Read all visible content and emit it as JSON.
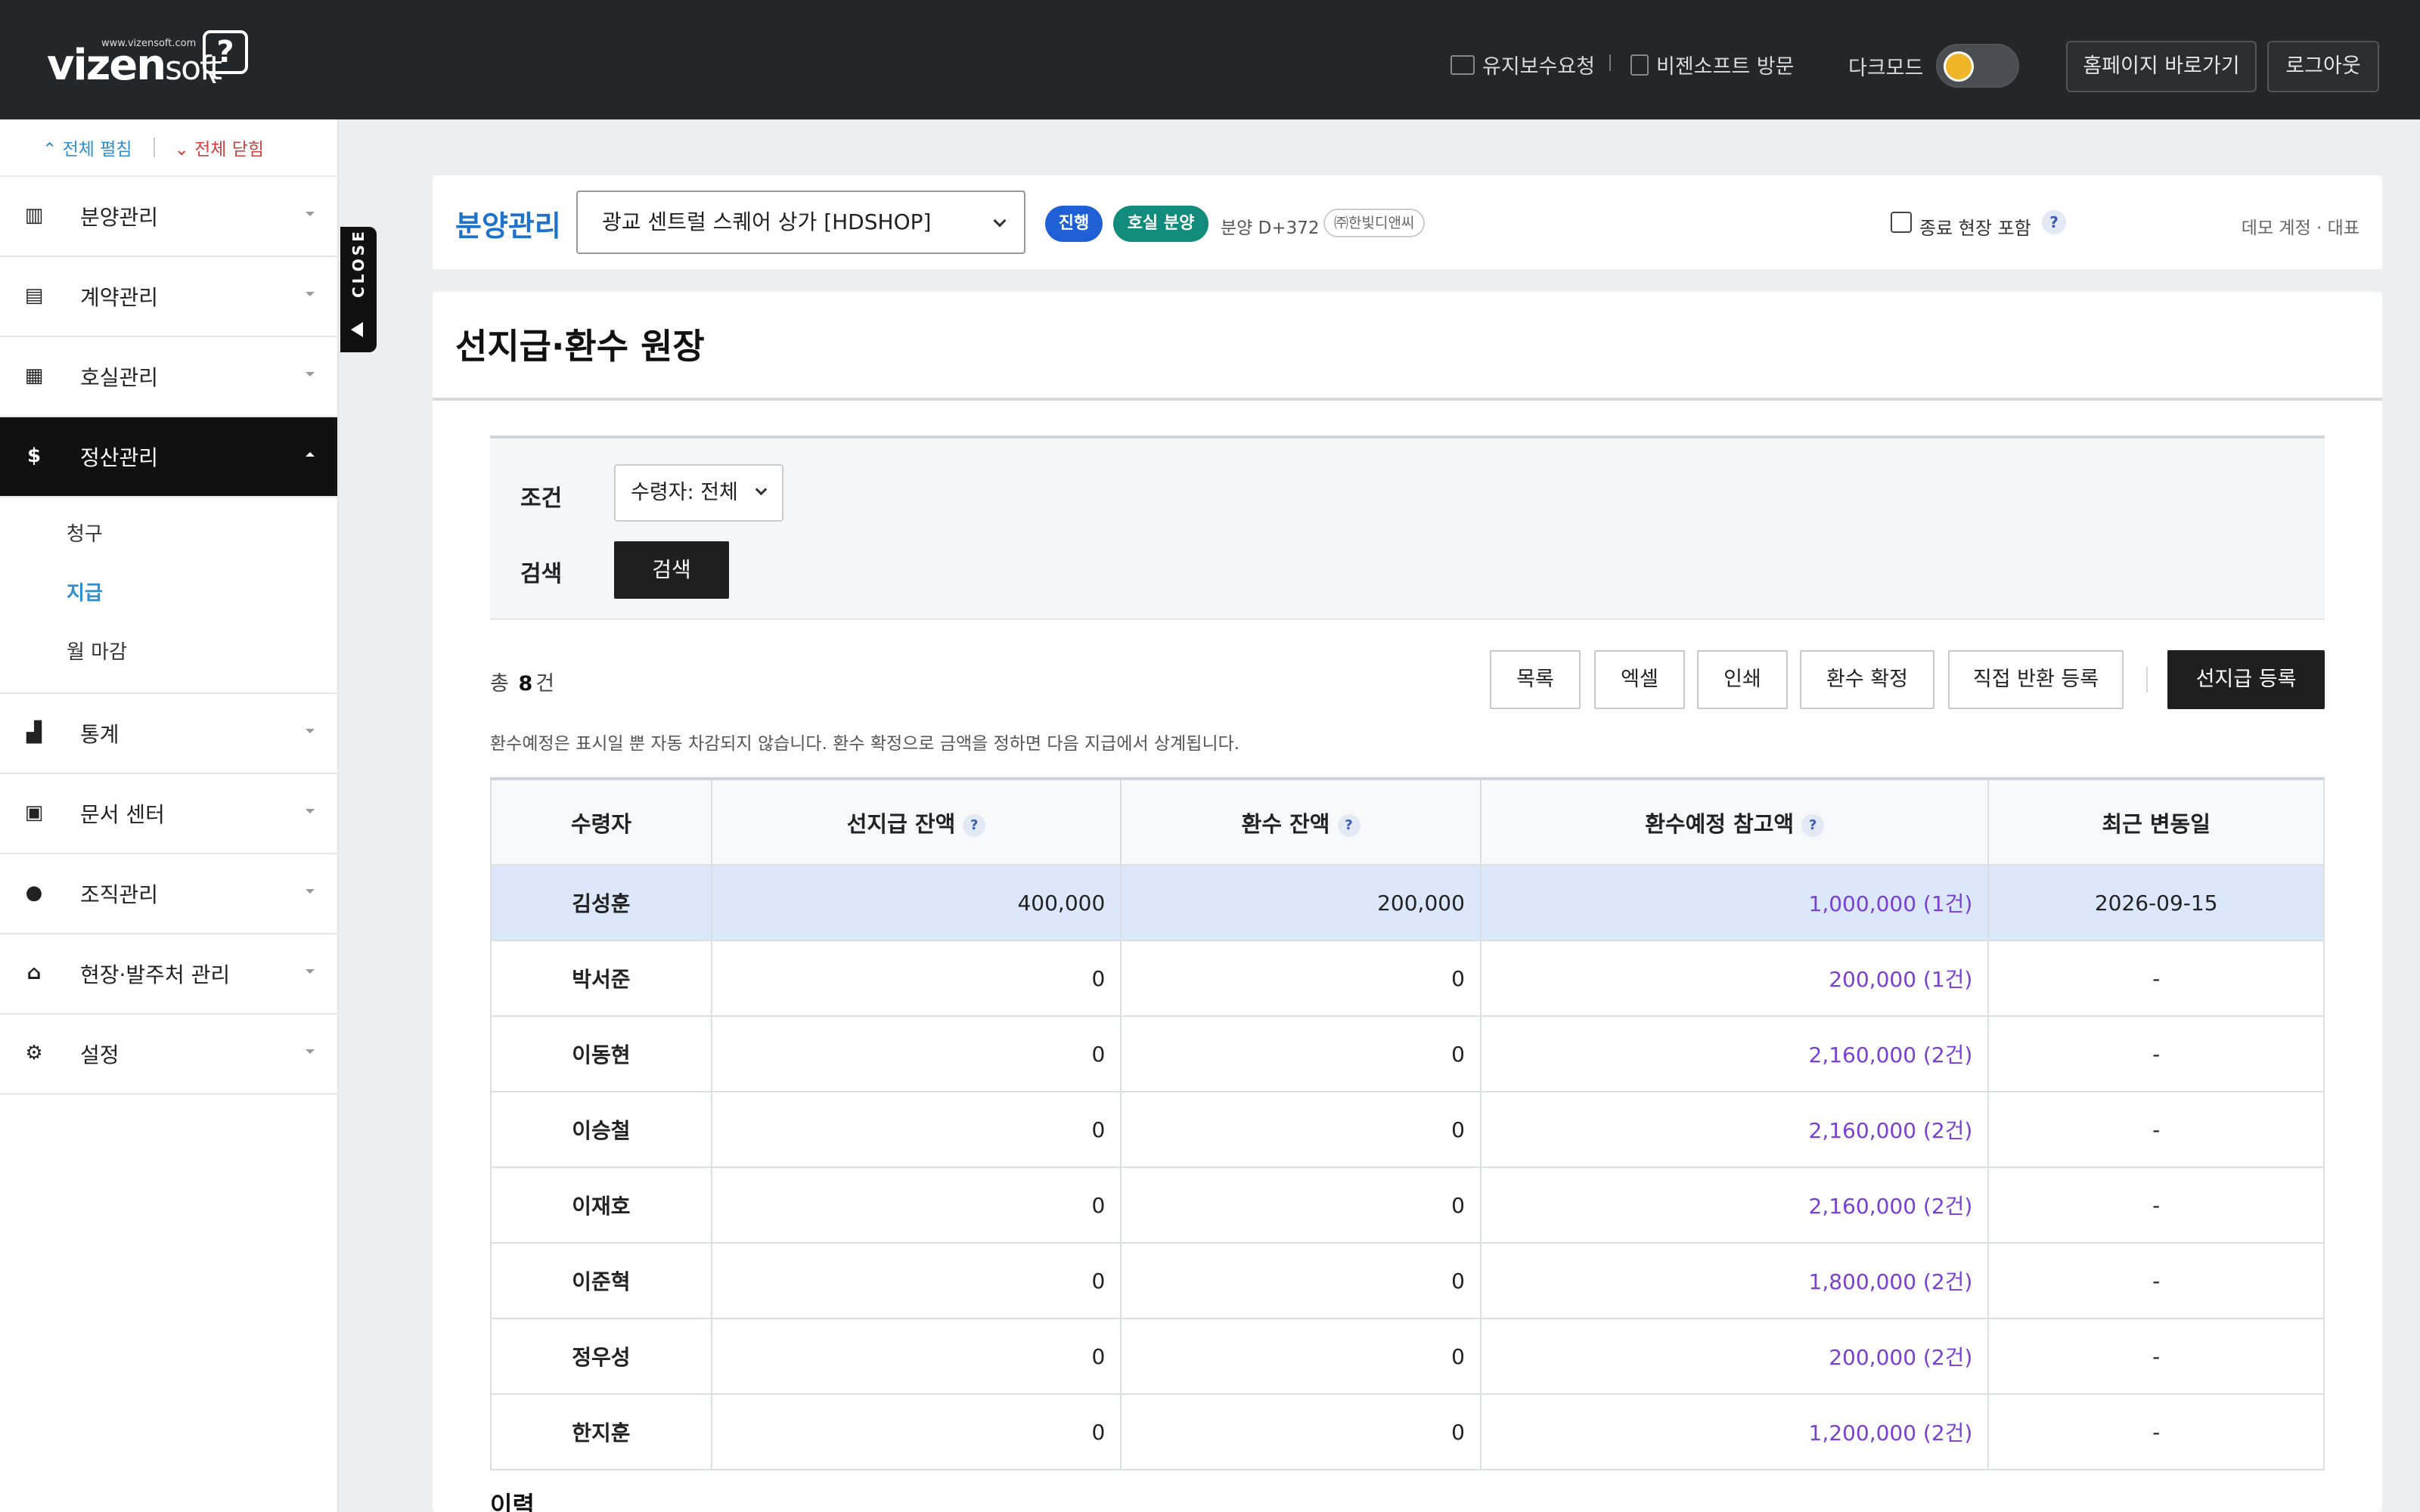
{
  "header": {
    "logo_url": "www.vizensoft.com",
    "logo_brand": "vizen",
    "logo_suffix": "soft",
    "logo_mark": "?",
    "maintenance_label": "유지보수요청",
    "visit_label": "비젠소프트 방문",
    "darkmode_label": "다크모드",
    "homepage_button": "홈페이지 바로가기",
    "logout_button": "로그아웃"
  },
  "sidebar": {
    "expand_all": "⌃ 전체 펼침",
    "collapse_all": "⌄ 전체 닫힘",
    "close_tab": "CLOSE",
    "items": [
      {
        "label": "분양관리",
        "icon": "building-icon"
      },
      {
        "label": "계약관리",
        "icon": "document-icon"
      },
      {
        "label": "호실관리",
        "icon": "grid-icon"
      },
      {
        "label": "정산관리",
        "icon": "dollar-icon"
      },
      {
        "label": "통계",
        "icon": "bar-chart-icon"
      },
      {
        "label": "문서 센터",
        "icon": "pdf-icon"
      },
      {
        "label": "조직관리",
        "icon": "people-icon"
      },
      {
        "label": "현장·발주처 관리",
        "icon": "bank-icon"
      },
      {
        "label": "설정",
        "icon": "settings-icon"
      }
    ],
    "submenu": [
      {
        "label": "청구"
      },
      {
        "label": "지급"
      },
      {
        "label": "월 마감"
      }
    ]
  },
  "site_bar": {
    "title": "분양관리",
    "selected_site": "광교 센트럴 스퀘어 상가 [HDSHOP]",
    "status_pill": "진행",
    "type_pill": "호실 분양",
    "dday": "분양 D+372",
    "company": "㈜한빛디앤씨",
    "include_closed_label": "종료 현장 포함",
    "help": "?",
    "user": "데모 계정 · 대표"
  },
  "page": {
    "title": "선지급·환수 원장",
    "filter": {
      "condition_label": "조건",
      "recipient_select": "수령자: 전체",
      "search_label": "검색",
      "search_button": "검색"
    },
    "total_prefix": "총",
    "total_count": "8",
    "total_suffix": "건",
    "buttons": {
      "list": "목록",
      "excel": "엑셀",
      "print": "인쇄",
      "confirm_recovery": "환수 확정",
      "direct_return": "직접 반환 등록",
      "register_advance": "선지급 등록"
    },
    "notice": "환수예정은 표시일 뿐 자동 차감되지 않습니다. 환수 확정으로 금액을 정하면 다음 지급에서 상계됩니다.",
    "table": {
      "headers": {
        "recipient": "수령자",
        "advance_balance": "선지급 잔액",
        "recovery_balance": "환수 잔액",
        "expected_recovery": "환수예정 참고액",
        "last_changed": "최근 변동일"
      },
      "rows": [
        {
          "name": "김성훈",
          "advance": "400,000",
          "recovery": "200,000",
          "expected": "1,000,000 (1건)",
          "date": "2026-09-15"
        },
        {
          "name": "박서준",
          "advance": "0",
          "recovery": "0",
          "expected": "200,000 (1건)",
          "date": "-"
        },
        {
          "name": "이동현",
          "advance": "0",
          "recovery": "0",
          "expected": "2,160,000 (2건)",
          "date": "-"
        },
        {
          "name": "이승철",
          "advance": "0",
          "recovery": "0",
          "expected": "2,160,000 (2건)",
          "date": "-"
        },
        {
          "name": "이재호",
          "advance": "0",
          "recovery": "0",
          "expected": "2,160,000 (2건)",
          "date": "-"
        },
        {
          "name": "이준혁",
          "advance": "0",
          "recovery": "0",
          "expected": "1,800,000 (2건)",
          "date": "-"
        },
        {
          "name": "정우성",
          "advance": "0",
          "recovery": "0",
          "expected": "200,000 (2건)",
          "date": "-"
        },
        {
          "name": "한지훈",
          "advance": "0",
          "recovery": "0",
          "expected": "1,200,000 (2건)",
          "date": "-"
        }
      ]
    },
    "history_title": "이력"
  },
  "colors": {
    "header_bg": "#24272a",
    "accent_blue": "#1f72c9",
    "status_blue": "#1f5fd6",
    "status_teal": "#118c7c",
    "selected_row": "#dbe8fb",
    "purple_amount": "#7b3fd6"
  }
}
